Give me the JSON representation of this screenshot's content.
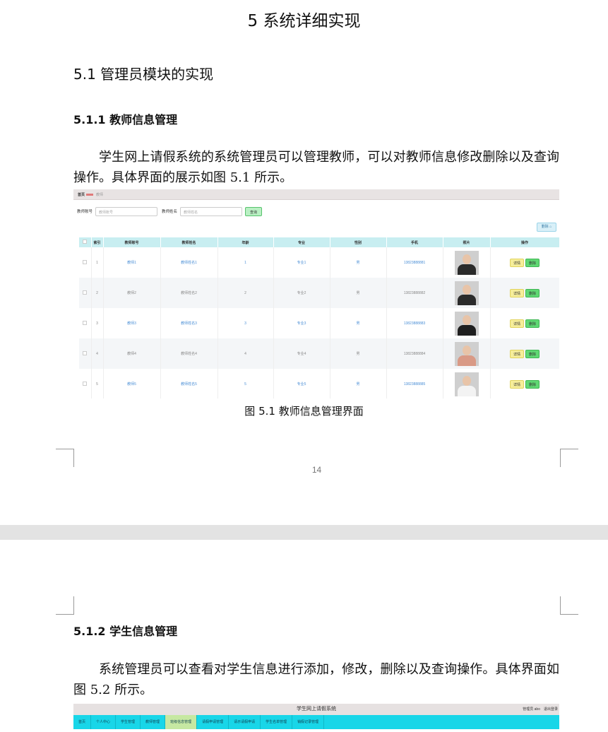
{
  "chapter_title": "5 系统详细实现",
  "section_title": "5.1 管理员模块的实现",
  "subsection_1": "5.1.1 教师信息管理",
  "paragraph_1": "学生网上请假系统的系统管理员可以管理教师，可以对教师信息修改删除以及查询操作。具体界面的展示如图 5.1 所示。",
  "figure_1": {
    "breadcrumb": [
      "首页",
      "教师"
    ],
    "search": {
      "label_account": "教师账号",
      "placeholder_account": "教师账号",
      "label_name": "教师姓名",
      "placeholder_name": "教师姓名",
      "button": "查询"
    },
    "delete_button": "删除",
    "columns": [
      "索引",
      "教师账号",
      "教师姓名",
      "年龄",
      "专业",
      "性别",
      "手机",
      "照片",
      "操作"
    ],
    "rows": [
      {
        "index": "1",
        "account": "教师1",
        "name": "教师姓名1",
        "age": "1",
        "major": "专业1",
        "gender": "男",
        "phone": "13823888881"
      },
      {
        "index": "2",
        "account": "教师2",
        "name": "教师姓名2",
        "age": "2",
        "major": "专业2",
        "gender": "男",
        "phone": "13823888882"
      },
      {
        "index": "3",
        "account": "教师3",
        "name": "教师姓名3",
        "age": "3",
        "major": "专业3",
        "gender": "男",
        "phone": "13823888883"
      },
      {
        "index": "4",
        "account": "教师4",
        "name": "教师姓名4",
        "age": "4",
        "major": "专业4",
        "gender": "男",
        "phone": "13823888884"
      },
      {
        "index": "5",
        "account": "教师5",
        "name": "教师姓名5",
        "age": "5",
        "major": "专业5",
        "gender": "男",
        "phone": "13823888885"
      }
    ],
    "action_detail": "详情",
    "action_delete": "删除",
    "photo_colors": [
      "#2b2b2b",
      "#2b2b2b",
      "#1f1f1f",
      "#d99a86",
      "#f3f3f3"
    ]
  },
  "caption_1": "图 5.1 教师信息管理界面",
  "page_number": "14",
  "subsection_2": "5.1.2 学生信息管理",
  "paragraph_2": "系统管理员可以查看对学生信息进行添加，修改，删除以及查询操作。具体界面如图 5.2 所示。",
  "figure_2": {
    "title": "学生网上请假系统",
    "user": "管理员 abo　退出登录",
    "nav": [
      "首页",
      "个人中心",
      "学生管理",
      "教师管理",
      "班级信息管理",
      "请假申请管理",
      "请示请假申请",
      "学生名单管理",
      "销假记录管理"
    ]
  },
  "colors": {
    "table_header": "#c8eef1",
    "link": "#4b8fd6",
    "nav_bg": "#18d6e8",
    "detail_button": "#f6ee9a",
    "delete_button": "#5fd873"
  }
}
